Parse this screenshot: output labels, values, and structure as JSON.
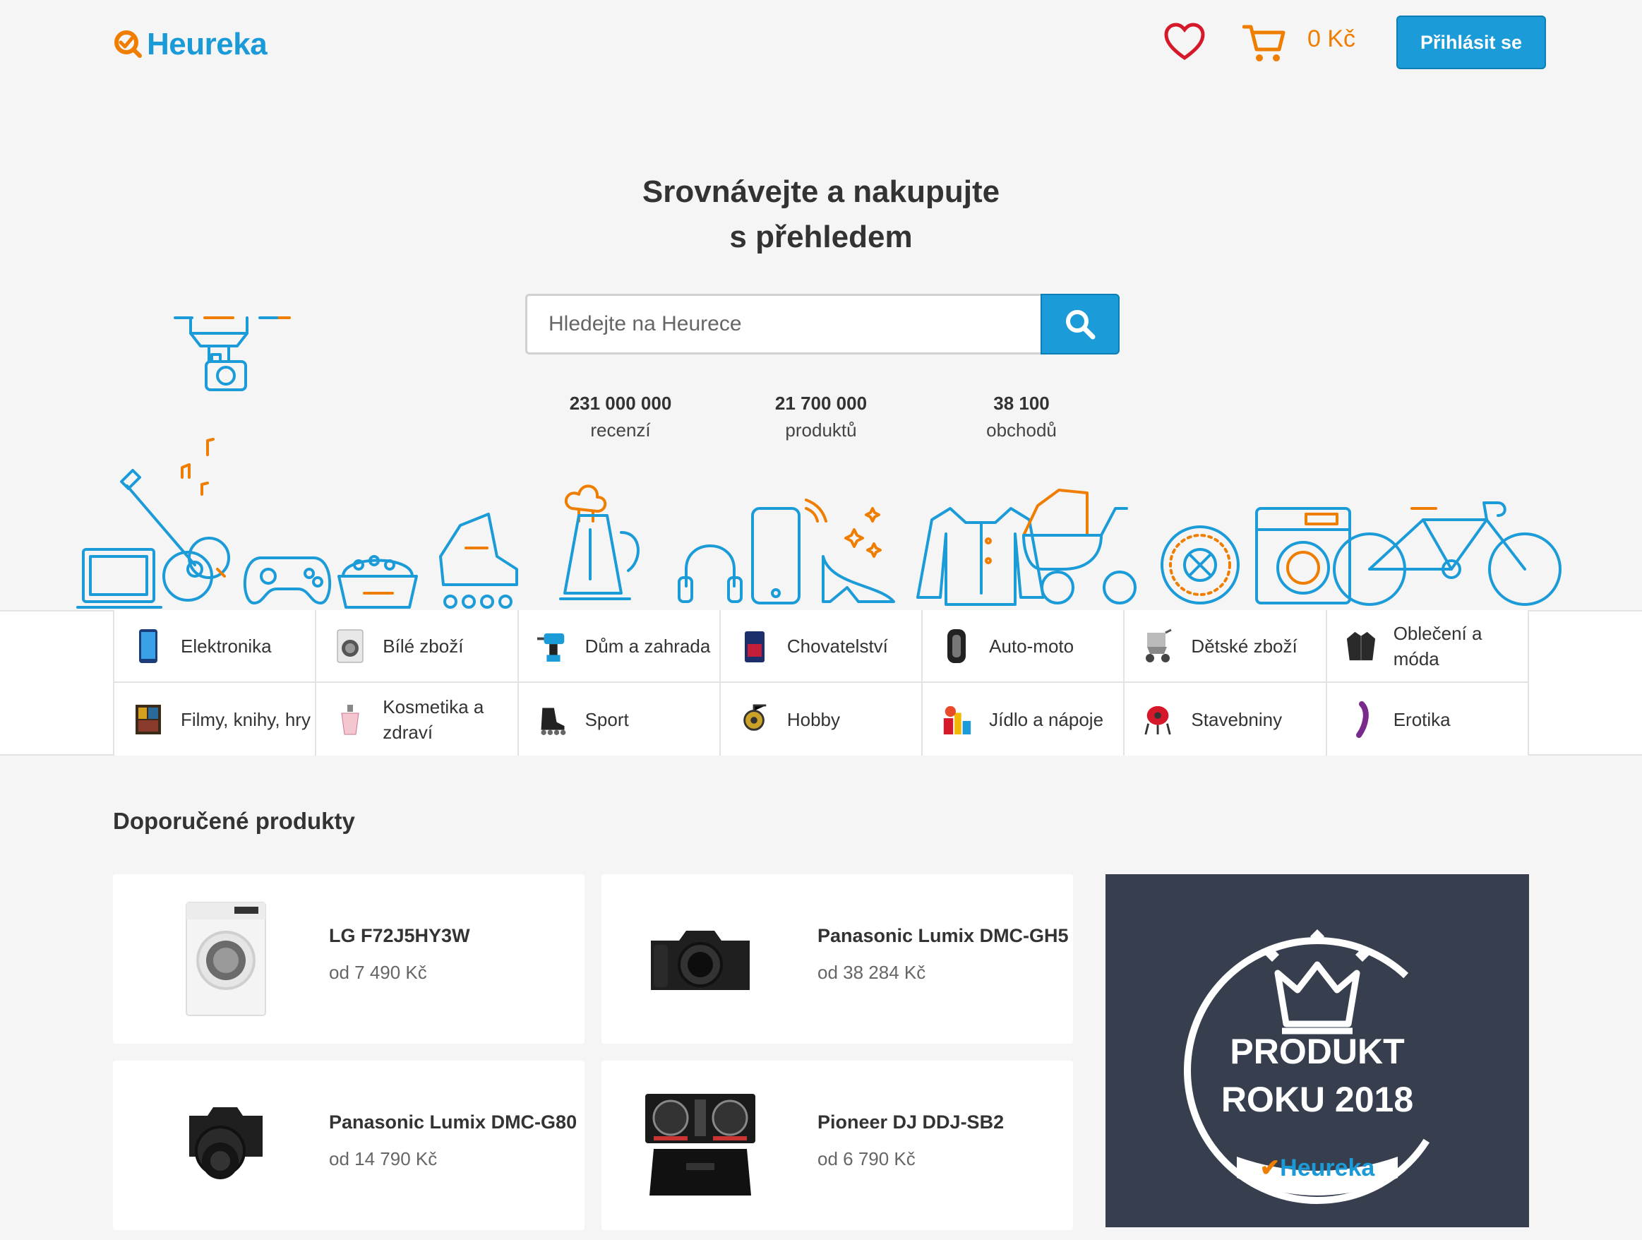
{
  "header": {
    "logo_text": "Heureka",
    "cart_amount": "0 Kč",
    "login_label": "Přihlásit se"
  },
  "hero": {
    "title_line1": "Srovnávejte a nakupujte",
    "title_line2": "s přehledem",
    "search_placeholder": "Hledejte na Heurece",
    "stats": [
      {
        "number": "231 000 000",
        "label": "recenzí"
      },
      {
        "number": "21 700 000",
        "label": "produktů"
      },
      {
        "number": "38 100",
        "label": "obchodů"
      }
    ]
  },
  "categories": [
    {
      "label": "Elektronika",
      "icon": "smartphone-icon"
    },
    {
      "label": "Bílé zboží",
      "icon": "washing-machine-icon"
    },
    {
      "label": "Dům a zahrada",
      "icon": "drill-icon"
    },
    {
      "label": "Chovatelství",
      "icon": "pet-food-icon"
    },
    {
      "label": "Auto-moto",
      "icon": "tire-icon"
    },
    {
      "label": "Dětské zboží",
      "icon": "stroller-icon"
    },
    {
      "label": "Oblečení a móda",
      "icon": "jacket-icon"
    },
    {
      "label": "Filmy, knihy, hry",
      "icon": "game-box-icon"
    },
    {
      "label": "Kosmetika a zdraví",
      "icon": "perfume-icon"
    },
    {
      "label": "Sport",
      "icon": "inline-skate-icon"
    },
    {
      "label": "Hobby",
      "icon": "fishing-reel-icon"
    },
    {
      "label": "Jídlo a nápoje",
      "icon": "food-icon"
    },
    {
      "label": "Stavebniny",
      "icon": "cement-mixer-icon"
    },
    {
      "label": "Erotika",
      "icon": "vibrator-icon"
    }
  ],
  "recommended": {
    "title": "Doporučené produkty",
    "products": [
      {
        "name": "LG F72J5HY3W",
        "price": "od 7 490 Kč",
        "icon": "washing-machine-icon"
      },
      {
        "name": "Panasonic Lumix DMC-GH5",
        "price": "od 38 284 Kč",
        "icon": "camera-icon"
      },
      {
        "name": "Panasonic Lumix DMC-G80",
        "price": "od 14 790 Kč",
        "icon": "camera-icon"
      },
      {
        "name": "Pioneer DJ DDJ-SB2",
        "price": "od 6 790 Kč",
        "icon": "dj-controller-icon"
      }
    ]
  },
  "banner": {
    "line1": "PRODUKT",
    "line2": "ROKU 2018",
    "logo_text": "Heureka"
  },
  "colors": {
    "brand_blue": "#1b9bd7",
    "accent_orange": "#ef7d00",
    "heart_red": "#d6182b",
    "banner_bg": "#373f4f"
  }
}
